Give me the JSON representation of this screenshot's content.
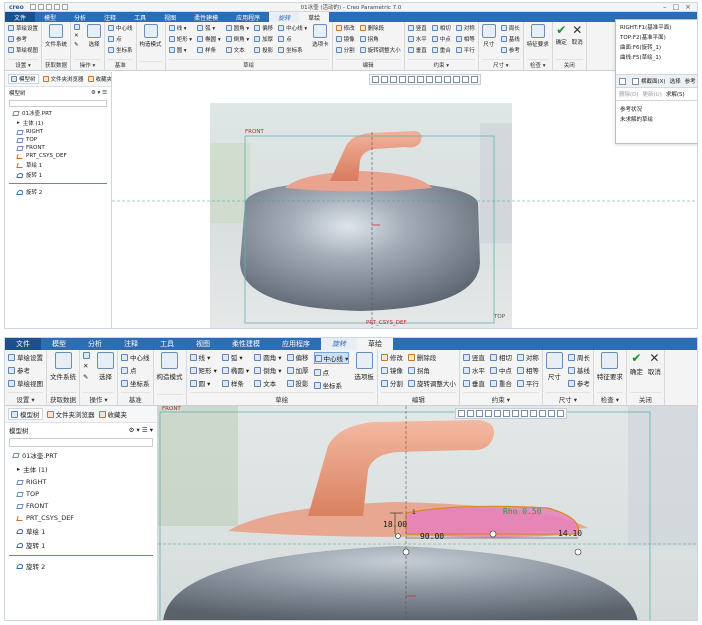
{
  "pane1": {
    "logo": "creo",
    "window_title": "01冰壶 (活动的) - Creo Parametric 7.0",
    "tabs": [
      "文件",
      "模型",
      "分析",
      "注释",
      "工具",
      "视图",
      "柔性建模",
      "应用程序",
      "旋转",
      "草绘"
    ],
    "ribbon": {
      "setup": {
        "label": "设置 ▾",
        "items": [
          "草绘设置",
          "参考",
          "草绘视图"
        ]
      },
      "get_data": {
        "label": "获取数据",
        "item": "文件系统"
      },
      "operations": {
        "label": "操作 ▾",
        "select": "选择",
        "items": [
          "",
          "✕",
          "✎"
        ]
      },
      "datum": {
        "label": "基准",
        "items": [
          "中心线",
          "点",
          "坐标系"
        ]
      },
      "construction": "构造模式",
      "sketch": {
        "label": "草绘",
        "col1": [
          "线 ▾",
          "矩形 ▾",
          "圆 ▾"
        ],
        "col2": [
          "弧 ▾",
          "椭圆 ▾",
          "样条"
        ],
        "col3": [
          "圆角 ▾",
          "倒角 ▾",
          "文本"
        ],
        "col4": [
          "偏移",
          "加厚",
          "投影"
        ],
        "col5": [
          "中心线 ▾",
          "点",
          "坐标系"
        ],
        "offset_big": "选项卡"
      },
      "edit": {
        "label": "编辑",
        "items": [
          "修改",
          "删除段",
          "镜像",
          "拐角",
          "分割",
          "旋转调整大小"
        ]
      },
      "constrain": {
        "label": "约束 ▾",
        "items": [
          "竖直",
          "相切",
          "对称",
          "水平",
          "中点",
          "相等",
          "垂直",
          "重合",
          "平行"
        ]
      },
      "dimension": {
        "label": "尺寸 ▾",
        "big": "尺寸",
        "items": [
          "周长",
          "基线",
          "参考"
        ]
      },
      "inspect": {
        "label": "检查 ▾",
        "big": "特征要求"
      },
      "close": {
        "label": "关闭",
        "ok": "确定",
        "cancel": "取消"
      }
    },
    "sidebar": {
      "tabs": [
        "模型树",
        "文件夹浏览器",
        "收藏夹"
      ],
      "tree_label": "模型树",
      "tree": [
        "01冰壶.PRT",
        "主体 (1)",
        "RIGHT",
        "TOP",
        "FRONT",
        "PRT_CSYS_DEF",
        "草绘 1",
        "旋转 1"
      ],
      "insert": "旋转 2"
    },
    "plane_labels": {
      "front": "FRONT",
      "csys": "PRT_CSYS_DEF",
      "top": "TOP"
    },
    "popup": {
      "refs": [
        "RIGHT:F1(基准平面)",
        "TOP:F2(基准平面)",
        "曲面:F6(旋转_1)",
        "曲线:F5(草绘_1)"
      ],
      "toolbar": [
        "",
        "横截面(X)",
        "选择",
        "参考"
      ],
      "actions": [
        "删除(D)",
        "更新(U)",
        "求解(S)"
      ],
      "status_title": "参考状况",
      "status": "未求解的草绘"
    }
  },
  "pane2": {
    "tabs": [
      "文件",
      "模型",
      "分析",
      "注释",
      "工具",
      "视图",
      "柔性建模",
      "应用程序",
      "旋转",
      "草绘"
    ],
    "ribbon": {
      "setup": {
        "label": "设置 ▾",
        "items": [
          "草绘设置",
          "参考",
          "草绘视图"
        ]
      },
      "get_data": {
        "label": "获取数据",
        "item": "文件系统"
      },
      "operations": {
        "label": "操作 ▾",
        "select": "选择",
        "items": [
          "",
          "✕",
          "✎"
        ]
      },
      "datum": {
        "label": "基准",
        "items": [
          "中心线",
          "点",
          "坐标系"
        ]
      },
      "construction": "构造模式",
      "sketch": {
        "label": "草绘",
        "col1": [
          "线 ▾",
          "矩形 ▾",
          "圆 ▾"
        ],
        "col2": [
          "弧 ▾",
          "椭圆 ▾",
          "样条"
        ],
        "col3": [
          "圆角 ▾",
          "倒角 ▾",
          "文本"
        ],
        "col4": [
          "偏移",
          "加厚",
          "投影"
        ],
        "col5": [
          "中心线 ▾",
          "点",
          "坐标系"
        ],
        "offset_big": "选项板"
      },
      "edit": {
        "label": "编辑",
        "items": [
          "修改",
          "删除段",
          "镜像",
          "拐角",
          "分割",
          "旋转调整大小"
        ]
      },
      "constrain": {
        "label": "约束 ▾",
        "items": [
          "竖直",
          "相切",
          "对称",
          "水平",
          "中点",
          "相等",
          "垂直",
          "重合",
          "平行"
        ]
      },
      "dimension": {
        "label": "尺寸 ▾",
        "big": "尺寸",
        "items": [
          "周长",
          "基线",
          "参考"
        ]
      },
      "inspect": {
        "label": "检查 ▾",
        "big": "特征要求"
      },
      "close": {
        "label": "关闭",
        "ok": "确定",
        "cancel": "取消"
      }
    },
    "sidebar": {
      "tabs": [
        "模型树",
        "文件夹浏览器",
        "收藏夹"
      ],
      "tree_label": "模型树",
      "tree": [
        "01冰壶.PRT",
        "主体 (1)",
        "RIGHT",
        "TOP",
        "FRONT",
        "PRT_CSYS_DEF",
        "草绘 1",
        "旋转 1"
      ],
      "insert": "旋转 2"
    },
    "plane_labels": {
      "front": "FRONT"
    },
    "dimensions": {
      "d1": "18.00",
      "d2": "90.00",
      "d3": "14.10",
      "d4": "Rho 0.50",
      "marker": "1"
    }
  }
}
